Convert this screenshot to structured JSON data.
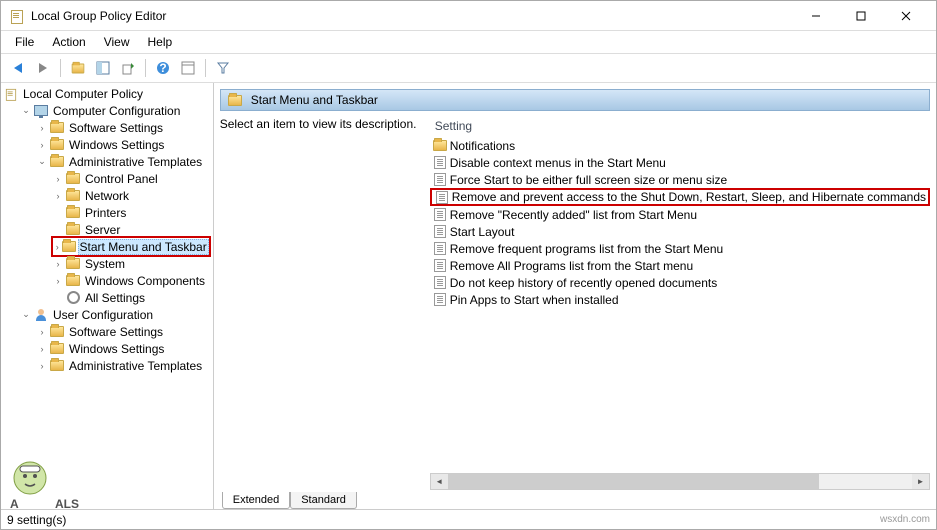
{
  "window": {
    "title": "Local Group Policy Editor"
  },
  "menubar": [
    "File",
    "Action",
    "View",
    "Help"
  ],
  "tree": {
    "root": "Local Computer Policy",
    "computer_config": "Computer Configuration",
    "cc_software": "Software Settings",
    "cc_windows": "Windows Settings",
    "cc_admin": "Administrative Templates",
    "at_control_panel": "Control Panel",
    "at_network": "Network",
    "at_printers": "Printers",
    "at_server": "Server",
    "at_start_menu": "Start Menu and Taskbar",
    "at_system": "System",
    "at_win_components": "Windows Components",
    "at_all_settings": "All Settings",
    "user_config": "User Configuration",
    "uc_software": "Software Settings",
    "uc_windows": "Windows Settings",
    "uc_admin": "Administrative Templates"
  },
  "right": {
    "header": "Start Menu and Taskbar",
    "desc_prompt": "Select an item to view its description.",
    "col_setting": "Setting"
  },
  "settings": {
    "s0": "Notifications",
    "s1": "Disable context menus in the Start Menu",
    "s2": "Force Start to be either full screen size or menu size",
    "s3": "Remove and prevent access to the Shut Down, Restart, Sleep, and Hibernate commands",
    "s4": "Remove \"Recently added\" list from Start Menu",
    "s5": "Start Layout",
    "s6": "Remove frequent programs list from the Start Menu",
    "s7": "Remove All Programs list from the Start menu",
    "s8": "Do not keep history of recently opened documents",
    "s9": "Pin Apps to Start when installed"
  },
  "tabs": {
    "extended": "Extended",
    "standard": "Standard"
  },
  "status": {
    "text": "9 setting(s)",
    "watermark": "wsxdn.com"
  }
}
